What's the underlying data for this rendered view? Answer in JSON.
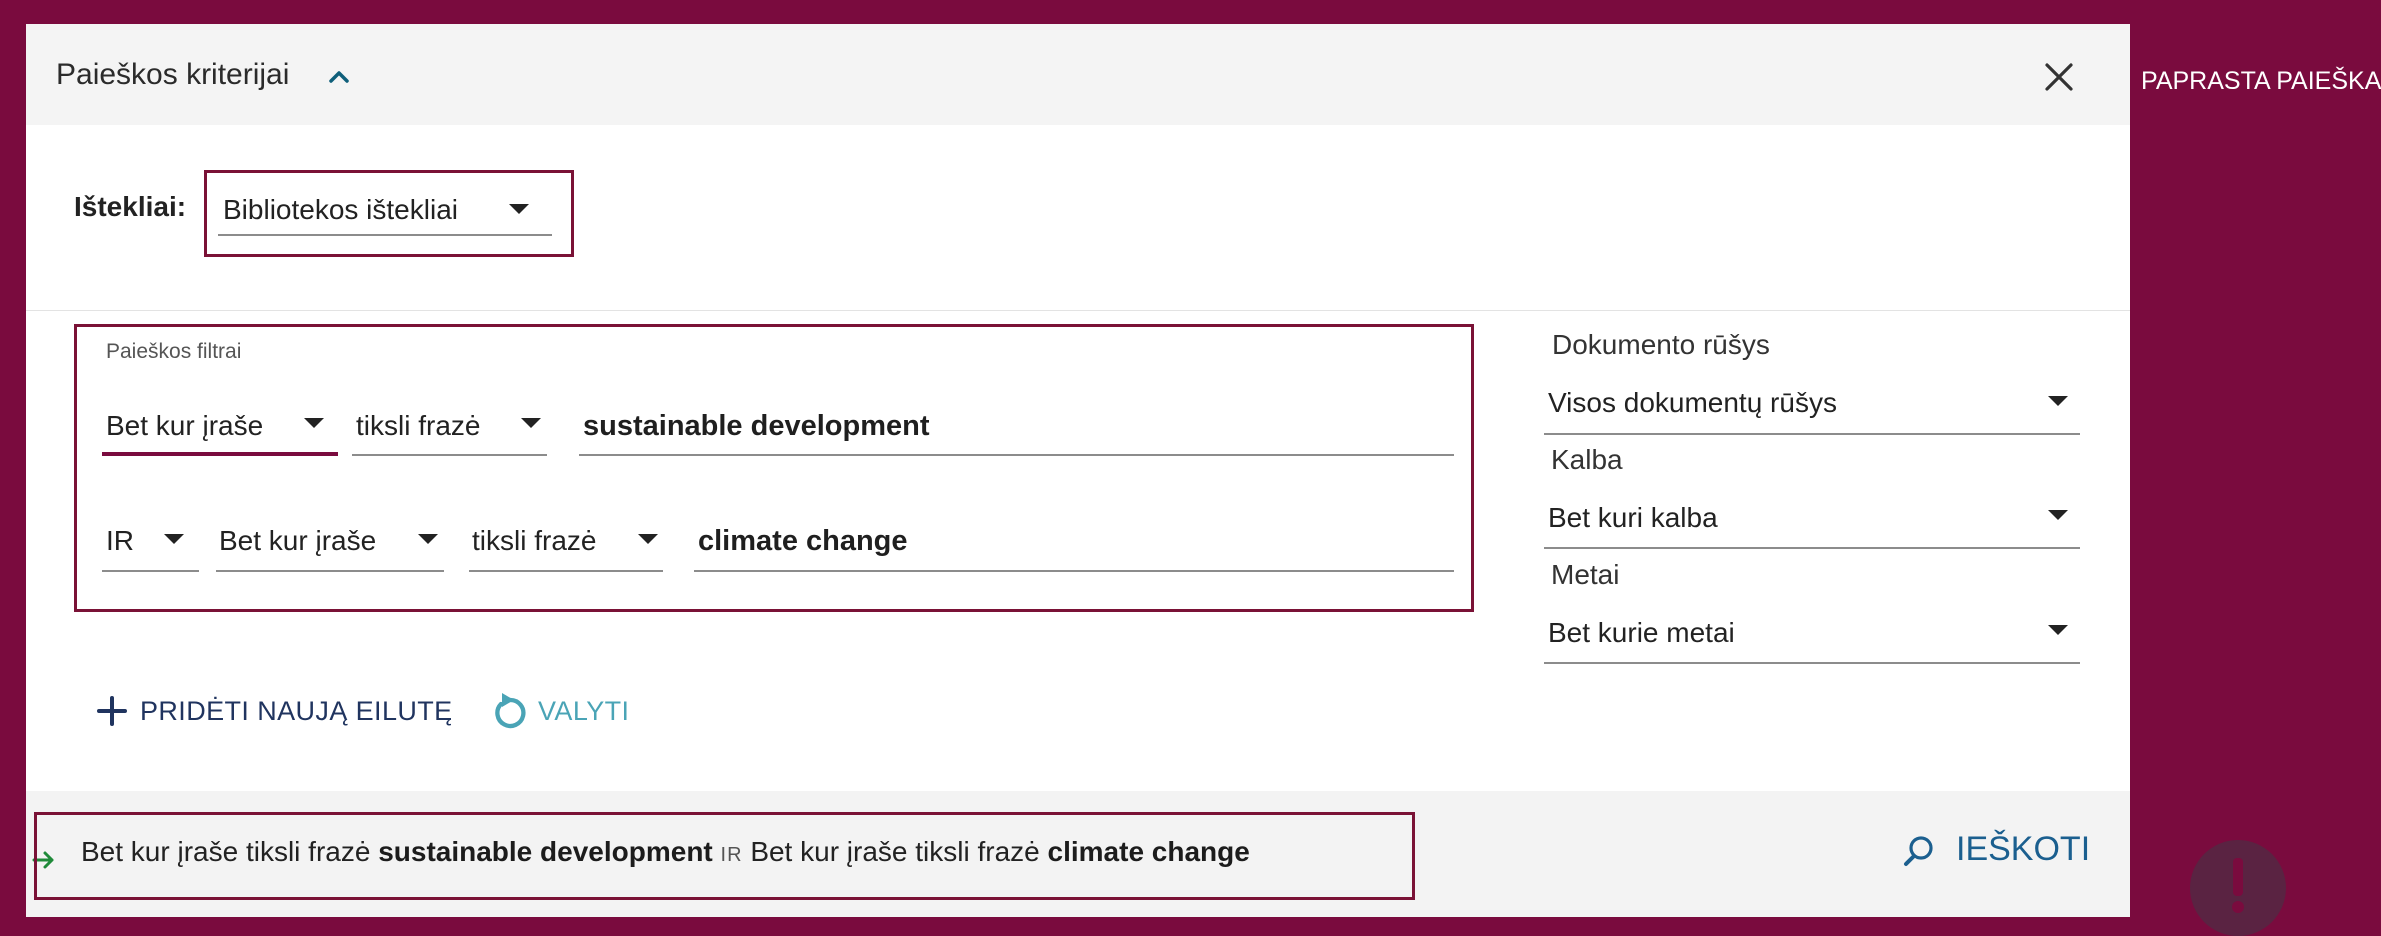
{
  "header": {
    "title": "Paieškos kriterijai"
  },
  "resources": {
    "label": "Ištekliai:",
    "value": "Bibliotekos ištekliai"
  },
  "filters": {
    "title": "Paieškos filtrai",
    "rows": [
      {
        "field": "Bet kur įraše",
        "match": "tiksli frazė",
        "value": "sustainable development"
      },
      {
        "operator": "IR",
        "field": "Bet kur įraše",
        "match": "tiksli frazė",
        "value": "climate change"
      }
    ]
  },
  "right_panel": {
    "document_types_label": "Dokumento rūšys",
    "document_types_value": "Visos dokumentų rūšys",
    "language_label": "Kalba",
    "language_value": "Bet kuri kalba",
    "year_label": "Metai",
    "year_value": "Bet kurie metai"
  },
  "actions": {
    "add_row_label": "PRIDĖTI NAUJĄ EILUTĘ",
    "clear_label": "VALYTI"
  },
  "summary": {
    "part1_field": "Bet kur įraše",
    "part1_match": "tiksli frazė",
    "part1_value": "sustainable development",
    "operator": "IR",
    "part2_field": "Bet kur įraše",
    "part2_match": "tiksli frazė",
    "part2_value": "climate change"
  },
  "search_button_label": "IEŠKOTI",
  "side_nav_label": "PAPRASTA PAIEŠKA"
}
